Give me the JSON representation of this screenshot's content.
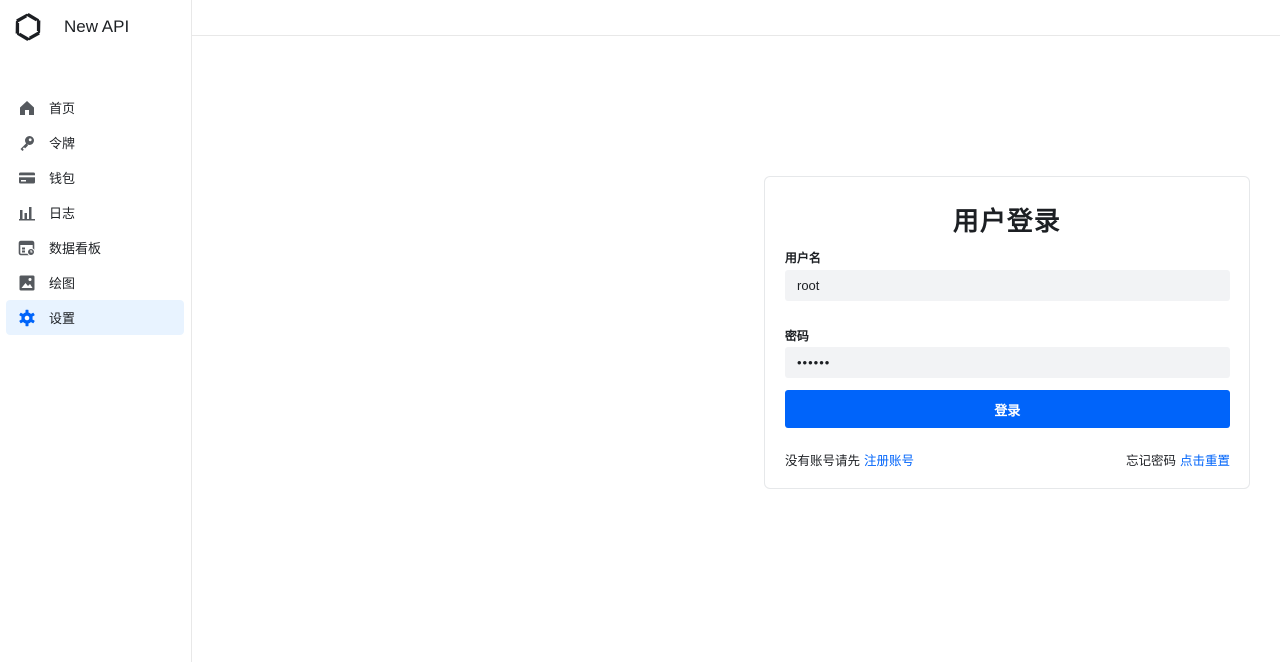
{
  "brand": {
    "name": "New API",
    "logo_icon": "openai-logo"
  },
  "sidebar": {
    "items": [
      {
        "label": "首页",
        "icon": "home-icon",
        "active": false
      },
      {
        "label": "令牌",
        "icon": "key-icon",
        "active": false
      },
      {
        "label": "钱包",
        "icon": "wallet-icon",
        "active": false
      },
      {
        "label": "日志",
        "icon": "bar-chart-icon",
        "active": false
      },
      {
        "label": "数据看板",
        "icon": "dashboard-icon",
        "active": false
      },
      {
        "label": "绘图",
        "icon": "image-icon",
        "active": false
      },
      {
        "label": "设置",
        "icon": "gear-icon",
        "active": true
      }
    ]
  },
  "login": {
    "title": "用户登录",
    "username_label": "用户名",
    "username_value": "root",
    "password_label": "密码",
    "password_value": "••••••",
    "submit_label": "登录",
    "no_account_text": "没有账号请先",
    "register_link": "注册账号",
    "forgot_text": "忘记密码",
    "reset_link": "点击重置"
  },
  "colors": {
    "accent": "#0064fa",
    "active_bg": "#e8f3ff",
    "input_bg": "#f2f3f5",
    "icon": "#55595e"
  }
}
